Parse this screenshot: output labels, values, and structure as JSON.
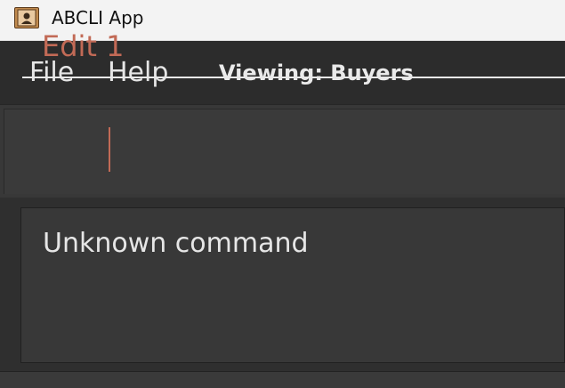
{
  "window": {
    "title": "ABCLI App",
    "icon": "address-book-icon"
  },
  "menubar": {
    "items": [
      {
        "label": "File"
      },
      {
        "label": "Help"
      }
    ],
    "viewing_label": "Viewing: Buyers"
  },
  "command": {
    "value": "Edit 1",
    "text_color": "#c26a56"
  },
  "result": {
    "message": "Unknown command"
  },
  "colors": {
    "background": "#3a3a3a",
    "menubar": "#2c2c2c",
    "titlebar": "#f3f3f3",
    "error_text": "#c26a56"
  }
}
